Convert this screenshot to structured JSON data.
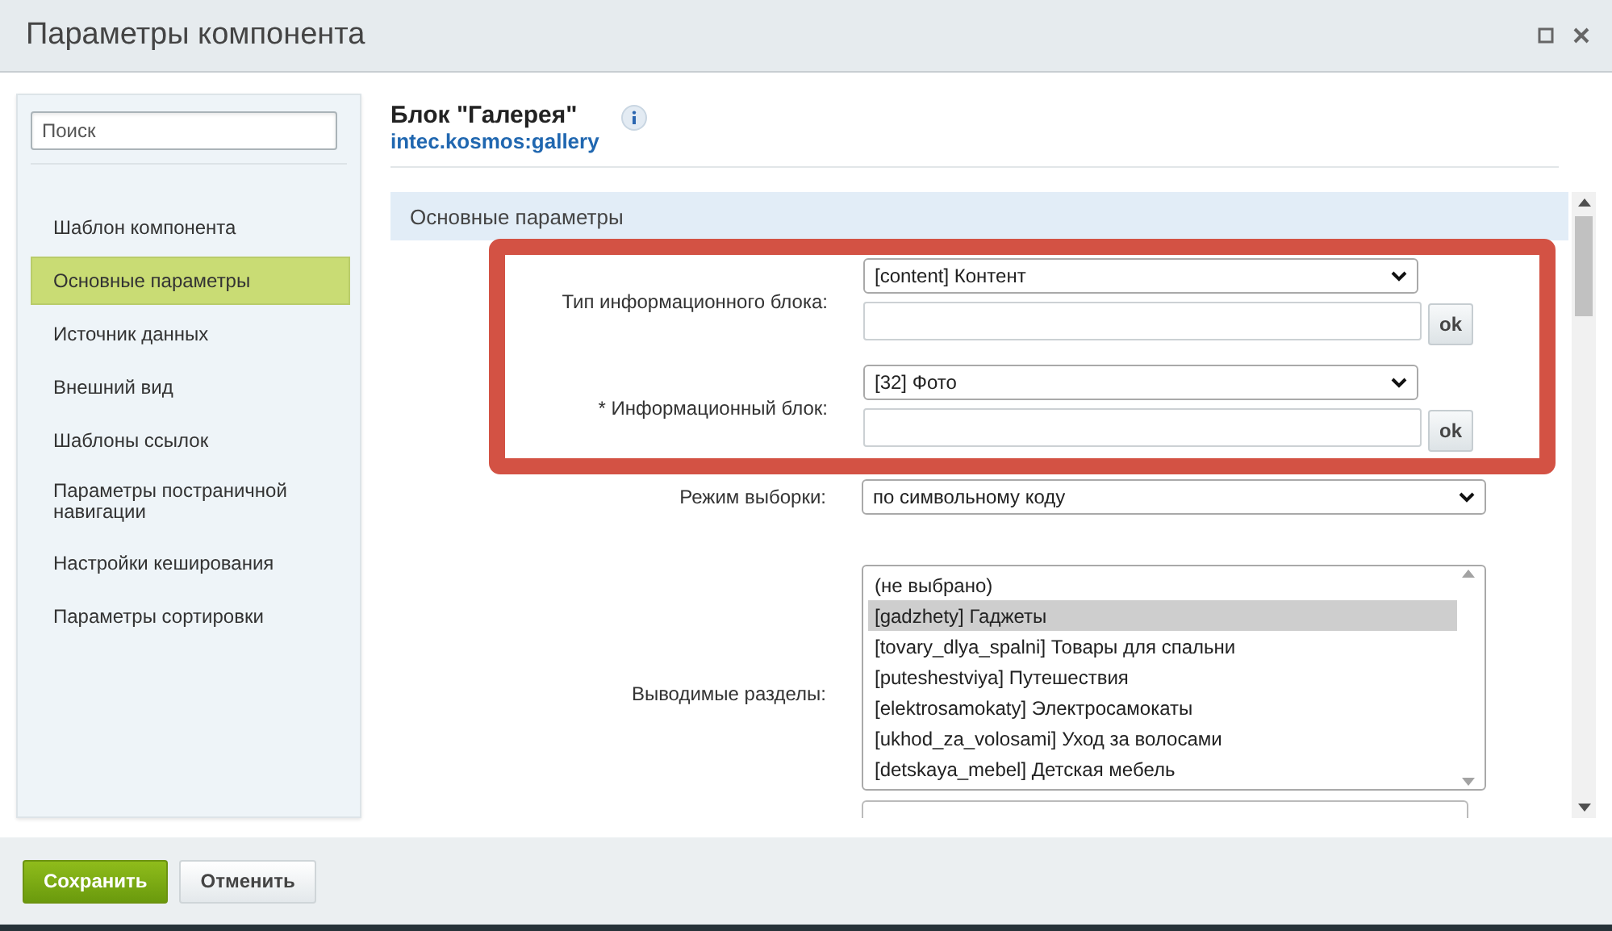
{
  "window": {
    "title": "Параметры компонента"
  },
  "sidebar": {
    "search": {
      "placeholder": "Поиск"
    },
    "items": [
      {
        "label": "Шаблон компонента",
        "selected": false
      },
      {
        "label": "Основные параметры",
        "selected": true
      },
      {
        "label": "Источник данных",
        "selected": false
      },
      {
        "label": "Внешний вид",
        "selected": false
      },
      {
        "label": "Шаблоны ссылок",
        "selected": false
      },
      {
        "label": "Параметры постраничной навигации",
        "selected": false
      },
      {
        "label": "Настройки кеширования",
        "selected": false
      },
      {
        "label": "Параметры сортировки",
        "selected": false
      }
    ]
  },
  "component": {
    "title": "Блок \"Галерея\"",
    "code": "intec.kosmos:gallery"
  },
  "section": {
    "title": "Основные параметры"
  },
  "highlighted_fields": [
    {
      "kind": "select-input",
      "label": "Тип информационного блока:",
      "value": "[content] Контент",
      "button": "ok"
    },
    {
      "kind": "select-input",
      "label": "* Информационный блок:",
      "value": "[32] Фото",
      "button": "ok"
    }
  ],
  "fields": [
    {
      "kind": "select",
      "label": "Режим выборки:",
      "value": "по символьному коду"
    },
    {
      "kind": "listbox",
      "label": "Выводимые разделы:",
      "options": [
        {
          "label": "(не выбрано)",
          "selected": false
        },
        {
          "label": "[gadzhety] Гаджеты",
          "selected": true
        },
        {
          "label": "[tovary_dlya_spalni] Товары для спальни",
          "selected": false
        },
        {
          "label": "[puteshestviya] Путешествия",
          "selected": false
        },
        {
          "label": "[elektrosamokaty] Электросамокаты",
          "selected": false
        },
        {
          "label": "[ukhod_za_volosami] Уход за волосами",
          "selected": false
        },
        {
          "label": "[detskaya_mebel] Детская мебель",
          "selected": false
        }
      ]
    }
  ],
  "footer": {
    "buttons": [
      {
        "label": "Сохранить",
        "kind": "primary"
      },
      {
        "label": "Отменить",
        "kind": "secondary"
      }
    ]
  }
}
